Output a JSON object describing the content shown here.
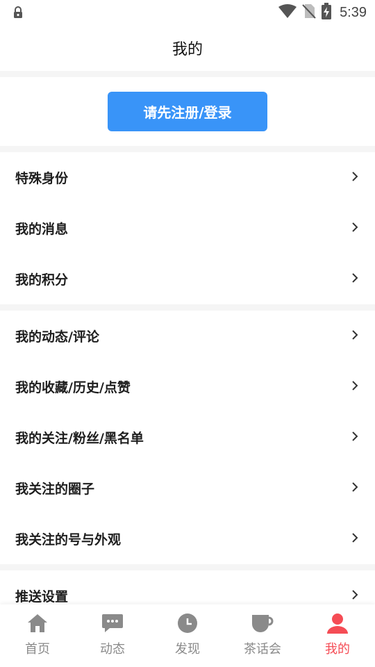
{
  "status_bar": {
    "time": "5:39"
  },
  "header": {
    "title": "我的"
  },
  "login": {
    "button_label": "请先注册/登录"
  },
  "menu_groups": [
    [
      {
        "label": "特殊身份"
      },
      {
        "label": "我的消息"
      },
      {
        "label": "我的积分"
      }
    ],
    [
      {
        "label": "我的动态/评论"
      },
      {
        "label": "我的收藏/历史/点赞"
      },
      {
        "label": "我的关注/粉丝/黑名单"
      },
      {
        "label": "我关注的圈子"
      },
      {
        "label": "我关注的号与外观"
      }
    ],
    [
      {
        "label": "推送设置"
      }
    ]
  ],
  "tabs": [
    {
      "label": "首页",
      "icon": "home-icon"
    },
    {
      "label": "动态",
      "icon": "chat-icon"
    },
    {
      "label": "发现",
      "icon": "clock-icon"
    },
    {
      "label": "茶话会",
      "icon": "cup-icon"
    },
    {
      "label": "我的",
      "icon": "person-icon",
      "active": true
    }
  ],
  "colors": {
    "accent": "#3994f8",
    "active_tab": "#f54c55",
    "inactive_tab": "#8a8a8a",
    "background": "#f5f5f5"
  }
}
